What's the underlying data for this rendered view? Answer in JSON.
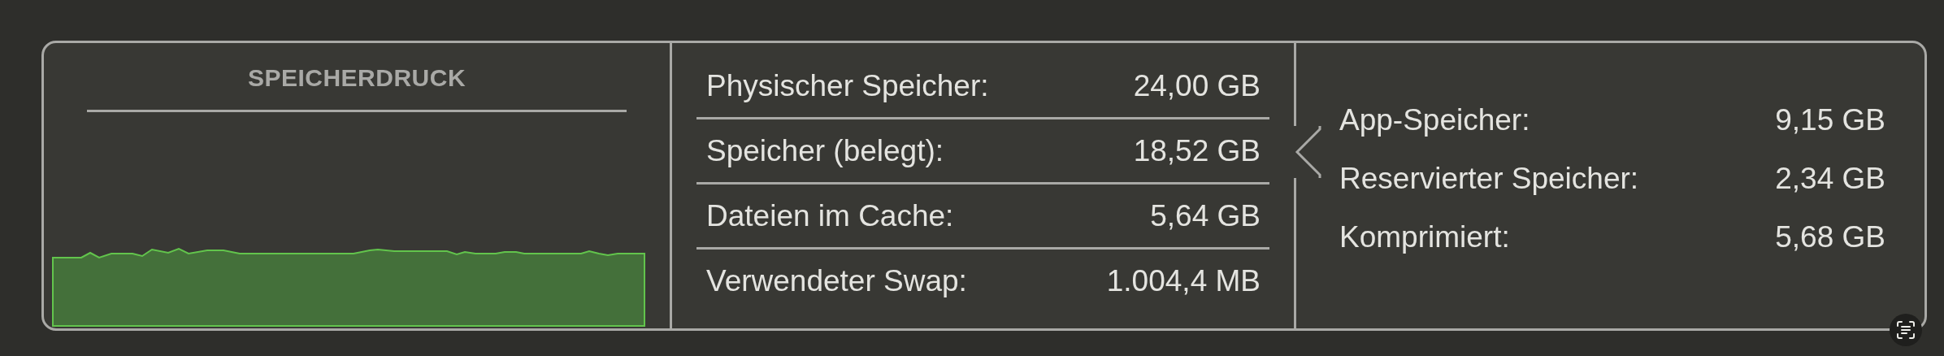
{
  "pressure": {
    "title": "SPEICHERDRUCK"
  },
  "memory": [
    {
      "label": "Physischer Speicher:",
      "value": "24,00 GB",
      "selected": false
    },
    {
      "label": "Speicher (belegt):",
      "value": "18,52 GB",
      "selected": true
    },
    {
      "label": "Dateien im Cache:",
      "value": "5,64 GB",
      "selected": false
    },
    {
      "label": "Verwendeter Swap:",
      "value": "1.004,4 MB",
      "selected": false
    }
  ],
  "breakdown": [
    {
      "label": "App-Speicher:",
      "value": "9,15 GB"
    },
    {
      "label": "Reservierter Speicher:",
      "value": "2,34 GB"
    },
    {
      "label": "Komprimiert:",
      "value": "5,68 GB"
    }
  ]
}
